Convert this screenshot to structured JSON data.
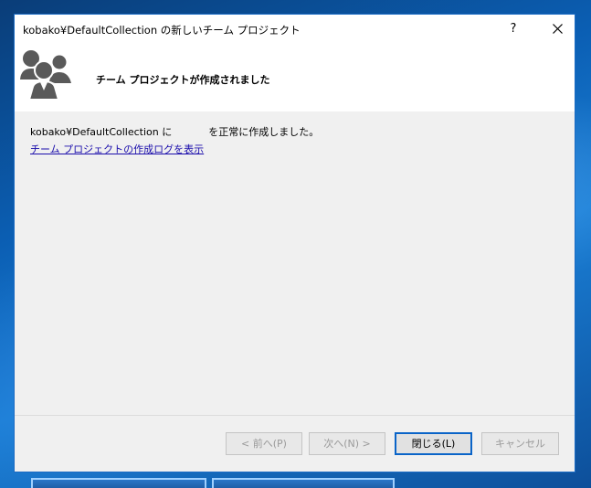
{
  "window": {
    "title": "kobako¥DefaultCollection の新しいチーム プロジェクト",
    "help_label": "?",
    "close_label": "close"
  },
  "header": {
    "icon": "team-icon",
    "title": "チーム プロジェクトが作成されました"
  },
  "body": {
    "message_part1": "kobako¥DefaultCollection に",
    "message_part2": "を正常に作成しました。",
    "log_link": "チーム プロジェクトの作成ログを表示"
  },
  "buttons": {
    "prev": "< 前へ(P)",
    "next": "次へ(N) >",
    "close": "閉じる(L)",
    "cancel": "キャンセル"
  },
  "colors": {
    "accent": "#0a64c8",
    "link": "#1a0dab",
    "disabled_text": "#9a9a9a",
    "desktop": "#0b5fb4"
  }
}
